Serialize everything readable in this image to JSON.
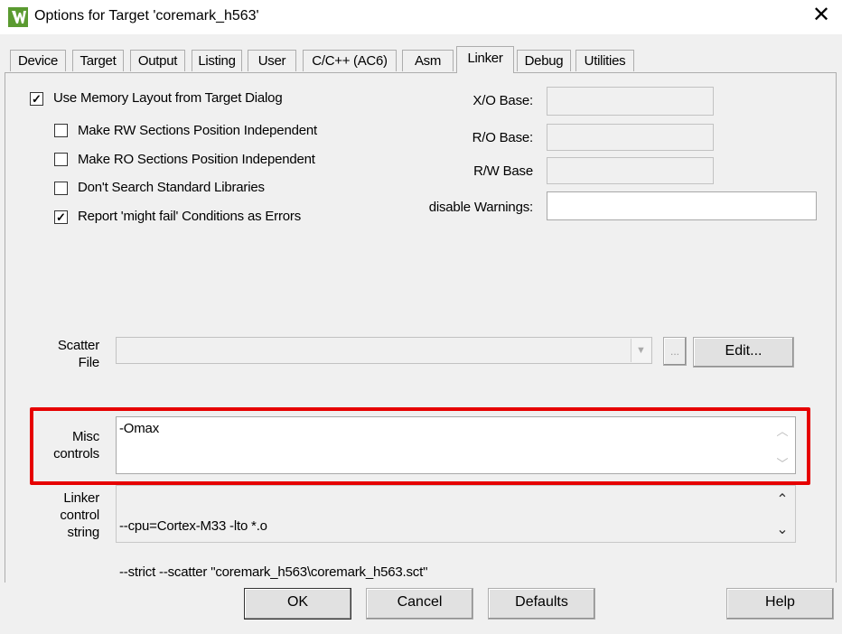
{
  "window": {
    "title": "Options for Target 'coremark_h563'",
    "close_glyph": "✕"
  },
  "tabs": [
    {
      "label": "Device"
    },
    {
      "label": "Target"
    },
    {
      "label": "Output"
    },
    {
      "label": "Listing"
    },
    {
      "label": "User"
    },
    {
      "label": "C/C++ (AC6)"
    },
    {
      "label": "Asm"
    },
    {
      "label": "Linker",
      "active": true
    },
    {
      "label": "Debug"
    },
    {
      "label": "Utilities"
    }
  ],
  "options": {
    "use_memory_layout": {
      "label": "Use Memory Layout from Target Dialog",
      "checked": true
    },
    "make_rw_pi": {
      "label": "Make RW Sections Position Independent",
      "checked": false
    },
    "make_ro_pi": {
      "label": "Make RO Sections Position Independent",
      "checked": false
    },
    "dont_search_std_libs": {
      "label": "Don't Search Standard Libraries",
      "checked": false
    },
    "report_might_fail": {
      "label": "Report 'might fail' Conditions as Errors",
      "checked": true
    }
  },
  "bases": {
    "xo_label": "X/O Base:",
    "ro_label": "R/O Base:",
    "rw_label": "R/W Base",
    "disable_warnings_label": "disable Warnings:",
    "xo_value": "",
    "ro_value": "",
    "rw_value": "",
    "disable_warnings_value": ""
  },
  "scatter": {
    "label_line1": "Scatter",
    "label_line2": "File",
    "value": "",
    "browse_label": "...",
    "edit_label": "Edit..."
  },
  "misc": {
    "label_line1": "Misc",
    "label_line2": "controls",
    "value": "-Omax"
  },
  "linker_control": {
    "label_line1": "Linker",
    "label_line2": "control",
    "label_line3": "string",
    "line1": "--cpu=Cortex-M33 -lto *.o",
    "line2": "--strict --scatter \"coremark_h563\\coremark_h563.sct\""
  },
  "buttons": {
    "ok": "OK",
    "cancel": "Cancel",
    "defaults": "Defaults",
    "help": "Help"
  },
  "colors": {
    "highlight_box": "#e60000",
    "dialog_bg": "#f0f0f0"
  }
}
